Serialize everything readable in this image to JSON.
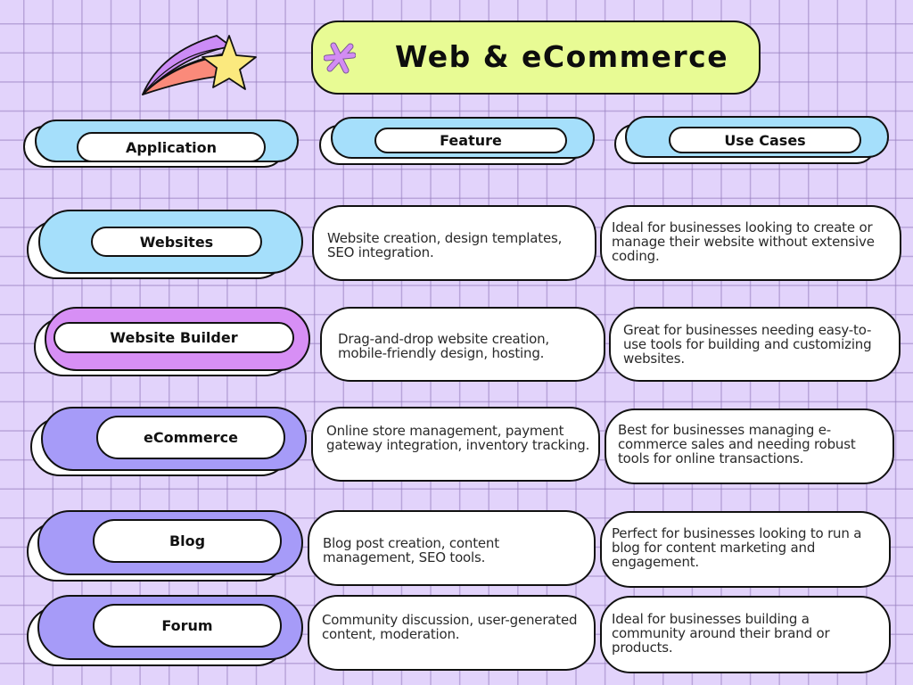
{
  "title": {
    "text": "Web & eCommerce",
    "icon": "asterisk-icon",
    "background_color": "#e8fb94"
  },
  "decoration": {
    "icon": "shooting-star-icon",
    "colors": {
      "star": "#fbe97e",
      "trail_top": "#cc8cf6",
      "trail_bottom": "#fa8a7a"
    }
  },
  "headers": {
    "application": "Application",
    "feature": "Feature",
    "use_cases": "Use Cases",
    "color": "#a5dffb"
  },
  "rows": [
    {
      "application": "Websites",
      "accent_color": "#a5dffb",
      "feature": "Website creation, design templates, SEO integration.",
      "use_case": "Ideal for businesses looking to create or manage their website without extensive coding."
    },
    {
      "application": "Website Builder",
      "accent_color": "#d78ff5",
      "feature": "Drag-and-drop website creation, mobile-friendly design, hosting.",
      "use_case": "Great for businesses needing easy-to-use tools for building and customizing websites."
    },
    {
      "application": "eCommerce",
      "accent_color": "#a69bf8",
      "feature": "Online store management, payment gateway integration, inventory tracking.",
      "use_case": "Best for businesses managing e-commerce sales and needing robust tools for online transactions."
    },
    {
      "application": "Blog",
      "accent_color": "#a69bf8",
      "feature": "Blog post creation, content management, SEO tools.",
      "use_case": "Perfect for businesses looking to run a blog for content marketing and engagement."
    },
    {
      "application": "Forum",
      "accent_color": "#a69bf8",
      "feature": "Community discussion, user-generated content, moderation.",
      "use_case": "Ideal for businesses building a community around their brand or products."
    }
  ],
  "background": {
    "color": "#e2d3fb",
    "grid_color": "#9a7dbe"
  }
}
